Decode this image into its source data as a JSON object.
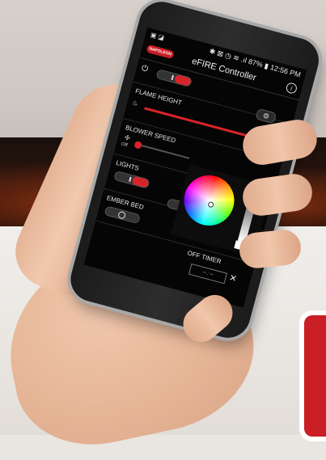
{
  "app": {
    "title": "eFIRE Controller",
    "brand": "NAPOLEON",
    "info_icon": "info-icon"
  },
  "status_bar": {
    "left_icons": "▣ ◪",
    "right": "✱ ⊠ ◷ ≋ .ıl 87% ▮ 12:56 PM"
  },
  "power": {
    "icon": "power-icon",
    "state": "on",
    "settings_icon": "gear-icon"
  },
  "flame_height": {
    "label": "FLAME HEIGHT",
    "value_fraction": 0.95
  },
  "blower_speed": {
    "label": "BLOWER SPEED",
    "fan_caption": "Off",
    "value_fraction": 0.0
  },
  "lights": {
    "label": "LIGHTS",
    "state": "on",
    "color_popup": {
      "brightness_fraction": 1.0,
      "selected_color": "#ffffff"
    }
  },
  "ember_bed": {
    "label": "EMBER BED",
    "state": "off"
  },
  "off_timer": {
    "label": "OFF TIMER",
    "value": "-- : --",
    "clear_label": "✕"
  },
  "colors": {
    "accent": "#d9232a",
    "screen_bg": "#050505"
  }
}
